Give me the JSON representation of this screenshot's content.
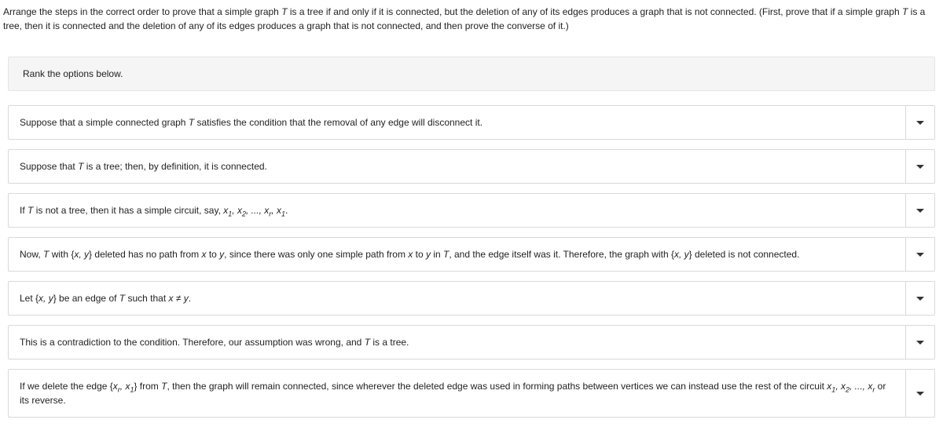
{
  "prompt": {
    "line1_a": "Arrange the steps in the correct order to prove that a simple graph ",
    "line1_b": " is a tree if and only if it is connected, but the deletion of any of its edges produces a graph that is not connected. (First, prove that if a simple graph ",
    "line1_c": " is a tree, then it is connected and the deletion of any of its edges produces a graph that is not connected, and then prove the converse of it.)",
    "T": "T"
  },
  "instruction": "Rank the options below.",
  "options": [
    {
      "pre": "Suppose that a simple connected graph ",
      "T": "T",
      "post": " satisfies the condition that the removal of any edge will disconnect it."
    },
    {
      "pre": "Suppose that ",
      "T": "T",
      "post": " is a tree; then, by definition, it is connected."
    },
    {
      "pre": "If ",
      "T": "T",
      "mid": " is not a tree, then it has a simple circuit, say, ",
      "seq": "x1, x2, ..., xr, x1",
      "post": "."
    },
    {
      "pre": "Now, ",
      "T": "T",
      "mid": " with {",
      "xy": "x, y",
      "mid2": "} deleted has no path from ",
      "x": "x",
      "to": " to ",
      "y": "y",
      "mid3": ", since there was only one simple path from ",
      "x2": "x",
      "to2": " to ",
      "y2": "y",
      "in": " in ",
      "T2": "T",
      "mid4": ", and the edge itself was it. Therefore, the graph with {",
      "xy2": "x, y",
      "post": "} deleted is not connected."
    },
    {
      "pre": "Let {",
      "xy": "x, y",
      "mid": "} be an edge of ",
      "T": "T",
      "mid2": " such that ",
      "x": "x",
      "ne": " ≠ ",
      "y": "y",
      "post": "."
    },
    {
      "pre": "This is a contradiction to the condition. Therefore, our assumption was wrong, and ",
      "T": "T",
      "post": " is a tree."
    },
    {
      "pre": "If we delete the edge {",
      "edge": "xr, x1",
      "mid": "} from ",
      "T": "T",
      "mid2": ", then the graph will remain connected, since wherever the deleted edge was used in forming paths between vertices we can instead use the rest of the circuit ",
      "seq": "x1, x2, ..., xr",
      "post": " or its reverse."
    }
  ]
}
